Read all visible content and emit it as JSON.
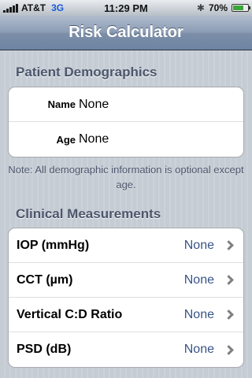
{
  "status_bar": {
    "carrier": "AT&T",
    "network": "3G",
    "time": "11:29 PM",
    "battery_percent": "70%",
    "bluetooth_icon": "bluetooth-icon",
    "battery_level": 0.7
  },
  "navbar": {
    "title": "Risk Calculator"
  },
  "demographics": {
    "header": "Patient Demographics",
    "rows": [
      {
        "label": "Name",
        "value": "None"
      },
      {
        "label": "Age",
        "value": "None"
      }
    ],
    "note": "Note: All demographic information is optional except age."
  },
  "clinical": {
    "header": "Clinical Measurements",
    "rows": [
      {
        "label": "IOP (mmHg)",
        "value": "None"
      },
      {
        "label": "CCT (µm)",
        "value": "None"
      },
      {
        "label": "Vertical C:D Ratio",
        "value": "None"
      },
      {
        "label": "PSD (dB)",
        "value": "None"
      }
    ]
  }
}
